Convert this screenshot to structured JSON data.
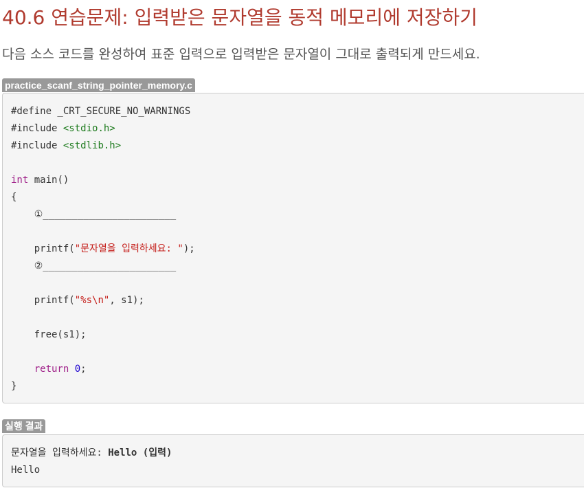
{
  "title": "40.6 연습문제: 입력받은 문자열을 동적 메모리에 저장하기",
  "description": "다음 소스 코드를 완성하여 표준 입력으로 입력받은 문자열이 그대로 출력되게 만드세요.",
  "file_label": "practice_scanf_string_pointer_memory.c",
  "code": {
    "l1": "#define _CRT_SECURE_NO_WARNINGS",
    "l2_pre": "#include",
    "l2_inc": "<stdio.h>",
    "l3_pre": "#include",
    "l3_inc": "<stdlib.h>",
    "l5_kw": "int",
    "l5_rest": "main()",
    "l6": "{",
    "l7_blank": "①_______________________",
    "l9_fn": "printf(",
    "l9_str": "\"문자열을 입력하세요: \"",
    "l9_end": ");",
    "l10_blank": "②_______________________",
    "l12_fn": "printf(",
    "l12_str": "\"%s\\n\"",
    "l12_end": ", s1);",
    "l14": "free(s1);",
    "l16_kw": "return",
    "l16_num": "0",
    "l16_end": ";",
    "l17": "}"
  },
  "result_label": "실행 결과",
  "result": {
    "prompt": "문자열을 입력하세요: ",
    "input": "Hello (입력)",
    "output": "Hello"
  }
}
